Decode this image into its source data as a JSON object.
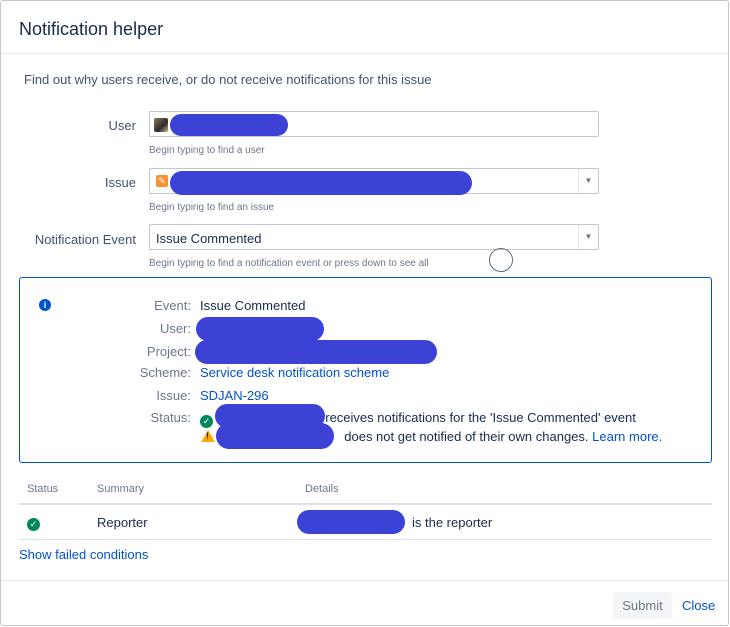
{
  "dialog": {
    "title": "Notification helper",
    "intro": "Find out why users receive, or do not receive notifications for this issue"
  },
  "form": {
    "user": {
      "label": "User",
      "value": "",
      "hint": "Begin typing to find a user"
    },
    "issue": {
      "label": "Issue",
      "value": "",
      "hint": "Begin typing to find an issue"
    },
    "event": {
      "label": "Notification Event",
      "value": "Issue Commented",
      "hint": "Begin typing to find a notification event or press down to see all"
    }
  },
  "info": {
    "event_label": "Event:",
    "event_value": "Issue Commented",
    "user_label": "User:",
    "project_label": "Project:",
    "scheme_label": "Scheme:",
    "scheme_value": "Service desk notification scheme",
    "issue_label": "Issue:",
    "issue_value": "SDJAN-296",
    "status_label": "Status:",
    "status_line1": "receives notifications for the 'Issue Commented' event",
    "status_line2": "does not get notified of their own changes.",
    "learn_more": "Learn more."
  },
  "results": {
    "headers": [
      "Status",
      "Summary",
      "Details"
    ],
    "rows": [
      {
        "status": "ok",
        "summary": "Reporter",
        "details": "is the reporter"
      }
    ]
  },
  "show_failed": "Show failed conditions",
  "footer": {
    "submit": "Submit",
    "close": "Close"
  },
  "colors": {
    "accent": "#0052cc",
    "success": "#00875a",
    "warning": "#ffab00",
    "redaction": "#3c42d6"
  }
}
